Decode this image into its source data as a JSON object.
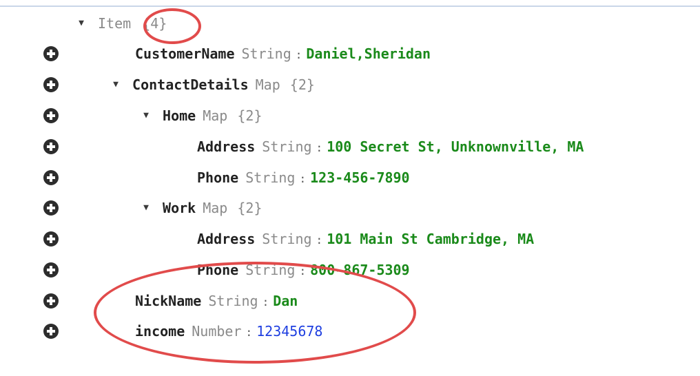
{
  "colors": {
    "string_value": "#1a8a1a",
    "number_value": "#1f3fe0",
    "type_label": "#8a8a8a",
    "annotation": "#e14b4b",
    "add_button": "#2d2d2d"
  },
  "icons": {
    "add": "plus-circle-icon",
    "expand": "triangle-down-icon"
  },
  "root": {
    "key": "Item",
    "count": "{4}",
    "expander": "▼"
  },
  "rows": {
    "customer_name": {
      "key": "CustomerName",
      "type": "String",
      "sep": ":",
      "value": "Daniel,Sheridan"
    },
    "contact_details": {
      "expander": "▼",
      "key": "ContactDetails",
      "type": "Map",
      "count": "{2}"
    },
    "home": {
      "expander": "▼",
      "key": "Home",
      "type": "Map",
      "count": "{2}"
    },
    "home_address": {
      "key": "Address",
      "type": "String",
      "sep": ":",
      "value": "100 Secret St, Unknownville, MA"
    },
    "home_phone": {
      "key": "Phone",
      "type": "String",
      "sep": ":",
      "value": "123-456-7890"
    },
    "work": {
      "expander": "▼",
      "key": "Work",
      "type": "Map",
      "count": "{2}"
    },
    "work_address": {
      "key": "Address",
      "type": "String",
      "sep": ":",
      "value": "101 Main St Cambridge, MA"
    },
    "work_phone": {
      "key": "Phone",
      "type": "String",
      "sep": ":",
      "value": "800-867-5309"
    },
    "nickname": {
      "key": "NickName",
      "type": "String",
      "sep": ":",
      "value": "Dan"
    },
    "income": {
      "key": "income",
      "type": "Number",
      "sep": ":",
      "value": "12345678"
    }
  }
}
